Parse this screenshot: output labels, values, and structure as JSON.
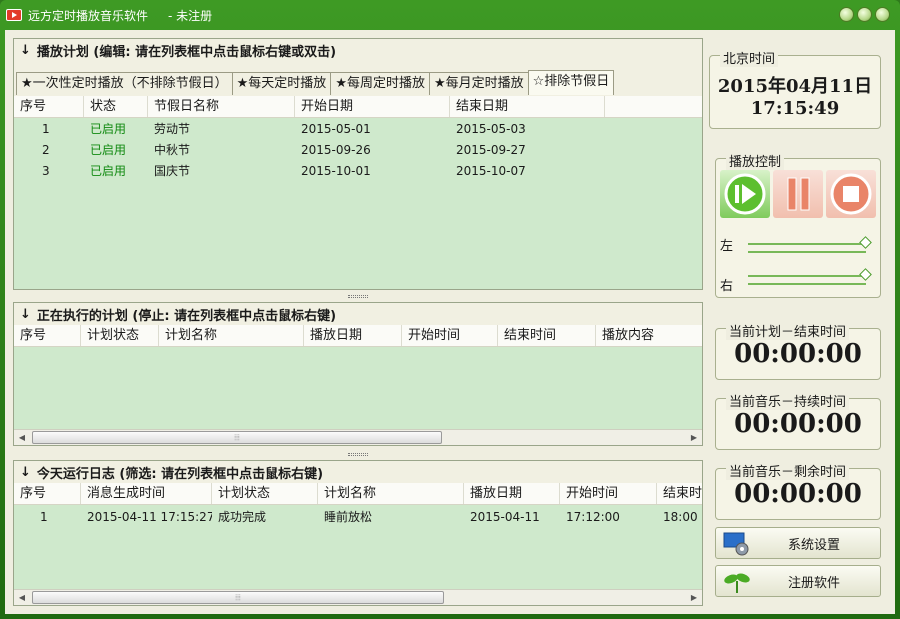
{
  "titlebar": {
    "app_name": "远方定时播放音乐软件",
    "reg_status": "- 未注册"
  },
  "plans": {
    "header": "播放计划 (编辑: 请在列表框中点击鼠标右键或双击)",
    "tabs": [
      "★一次性定时播放（不排除节假日）",
      "★每天定时播放",
      "★每周定时播放",
      "★每月定时播放",
      "☆排除节假日"
    ],
    "columns": [
      "序号",
      "状态",
      "节假日名称",
      "开始日期",
      "结束日期"
    ],
    "rows": [
      {
        "no": "1",
        "status": "已启用",
        "name": "劳动节",
        "start": "2015-05-01",
        "end": "2015-05-03"
      },
      {
        "no": "2",
        "status": "已启用",
        "name": "中秋节",
        "start": "2015-09-26",
        "end": "2015-09-27"
      },
      {
        "no": "3",
        "status": "已启用",
        "name": "国庆节",
        "start": "2015-10-01",
        "end": "2015-10-07"
      }
    ]
  },
  "running": {
    "header": "正在执行的计划 (停止: 请在列表框中点击鼠标右键)",
    "columns": [
      "序号",
      "计划状态",
      "计划名称",
      "播放日期",
      "开始时间",
      "结束时间",
      "播放内容"
    ]
  },
  "log": {
    "header": "今天运行日志 (筛选: 请在列表框中点击鼠标右键)",
    "columns": [
      "序号",
      "消息生成时间",
      "计划状态",
      "计划名称",
      "播放日期",
      "开始时间",
      "结束时"
    ],
    "rows": [
      {
        "no": "1",
        "time": "2015-04-11 17:15:27",
        "state": "成功完成",
        "name": "睡前放松",
        "date": "2015-04-11",
        "start": "17:12:00",
        "end": "18:00"
      }
    ]
  },
  "sidebar": {
    "clock_legend": "北京时间",
    "date": "2015年04月11日",
    "time": "17:15:49",
    "playback_legend": "播放控制",
    "left_label": "左",
    "right_label": "右",
    "plan_end_legend": "当前计划－结束时间",
    "plan_end": "00:00:00",
    "music_duration_legend": "当前音乐－持续时间",
    "music_duration": "00:00:00",
    "music_remaining_legend": "当前音乐－剩余时间",
    "music_remaining": "00:00:00",
    "settings_label": "系统设置",
    "register_label": "注册软件"
  }
}
